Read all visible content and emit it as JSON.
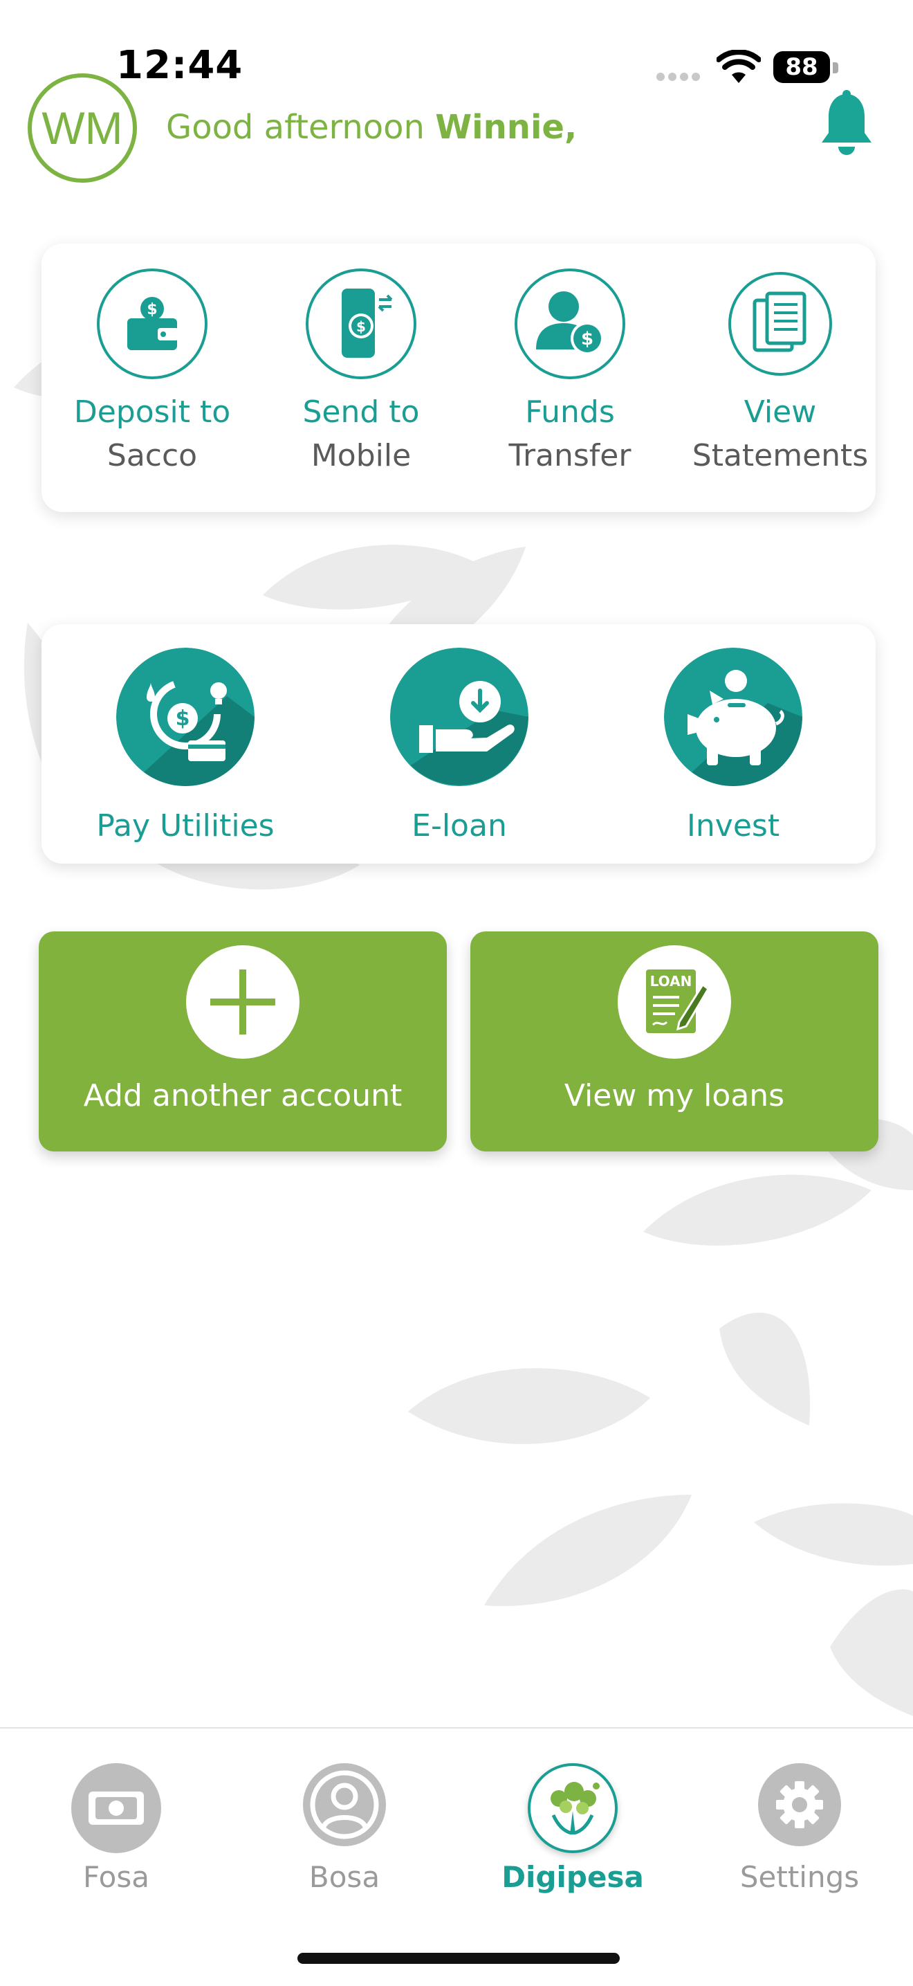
{
  "status_bar": {
    "time": "12:44",
    "battery": "88"
  },
  "header": {
    "avatar_initials": "WM",
    "greeting_prefix": "Good afternoon ",
    "user_name": "Winnie,"
  },
  "quick_actions": [
    {
      "line1": "Deposit to",
      "line2": "Sacco",
      "icon": "wallet-deposit-icon"
    },
    {
      "line1": "Send to",
      "line2": "Mobile",
      "icon": "mobile-send-icon"
    },
    {
      "line1": "Funds",
      "line2": "Transfer",
      "icon": "funds-transfer-icon"
    },
    {
      "line1": "View",
      "line2": "Statements",
      "icon": "statements-icon"
    }
  ],
  "services": [
    {
      "label": "Pay Utilities",
      "icon": "utilities-icon"
    },
    {
      "label": "E-loan",
      "icon": "e-loan-icon"
    },
    {
      "label": "Invest",
      "icon": "piggy-bank-icon"
    }
  ],
  "actions": {
    "add_account": "Add another account",
    "view_loans": "View my loans",
    "loan_badge": "LOAN"
  },
  "tabs": [
    {
      "label": "Fosa",
      "icon": "cash-icon",
      "active": false
    },
    {
      "label": "Bosa",
      "icon": "user-icon",
      "active": false
    },
    {
      "label": "Digipesa",
      "icon": "digipesa-logo-icon",
      "active": true
    },
    {
      "label": "Settings",
      "icon": "gear-icon",
      "active": false
    }
  ],
  "colors": {
    "brand_green": "#7cb342",
    "button_green": "#82b23e",
    "teal": "#1a9e94",
    "tab_inactive": "#9a9a9a"
  }
}
